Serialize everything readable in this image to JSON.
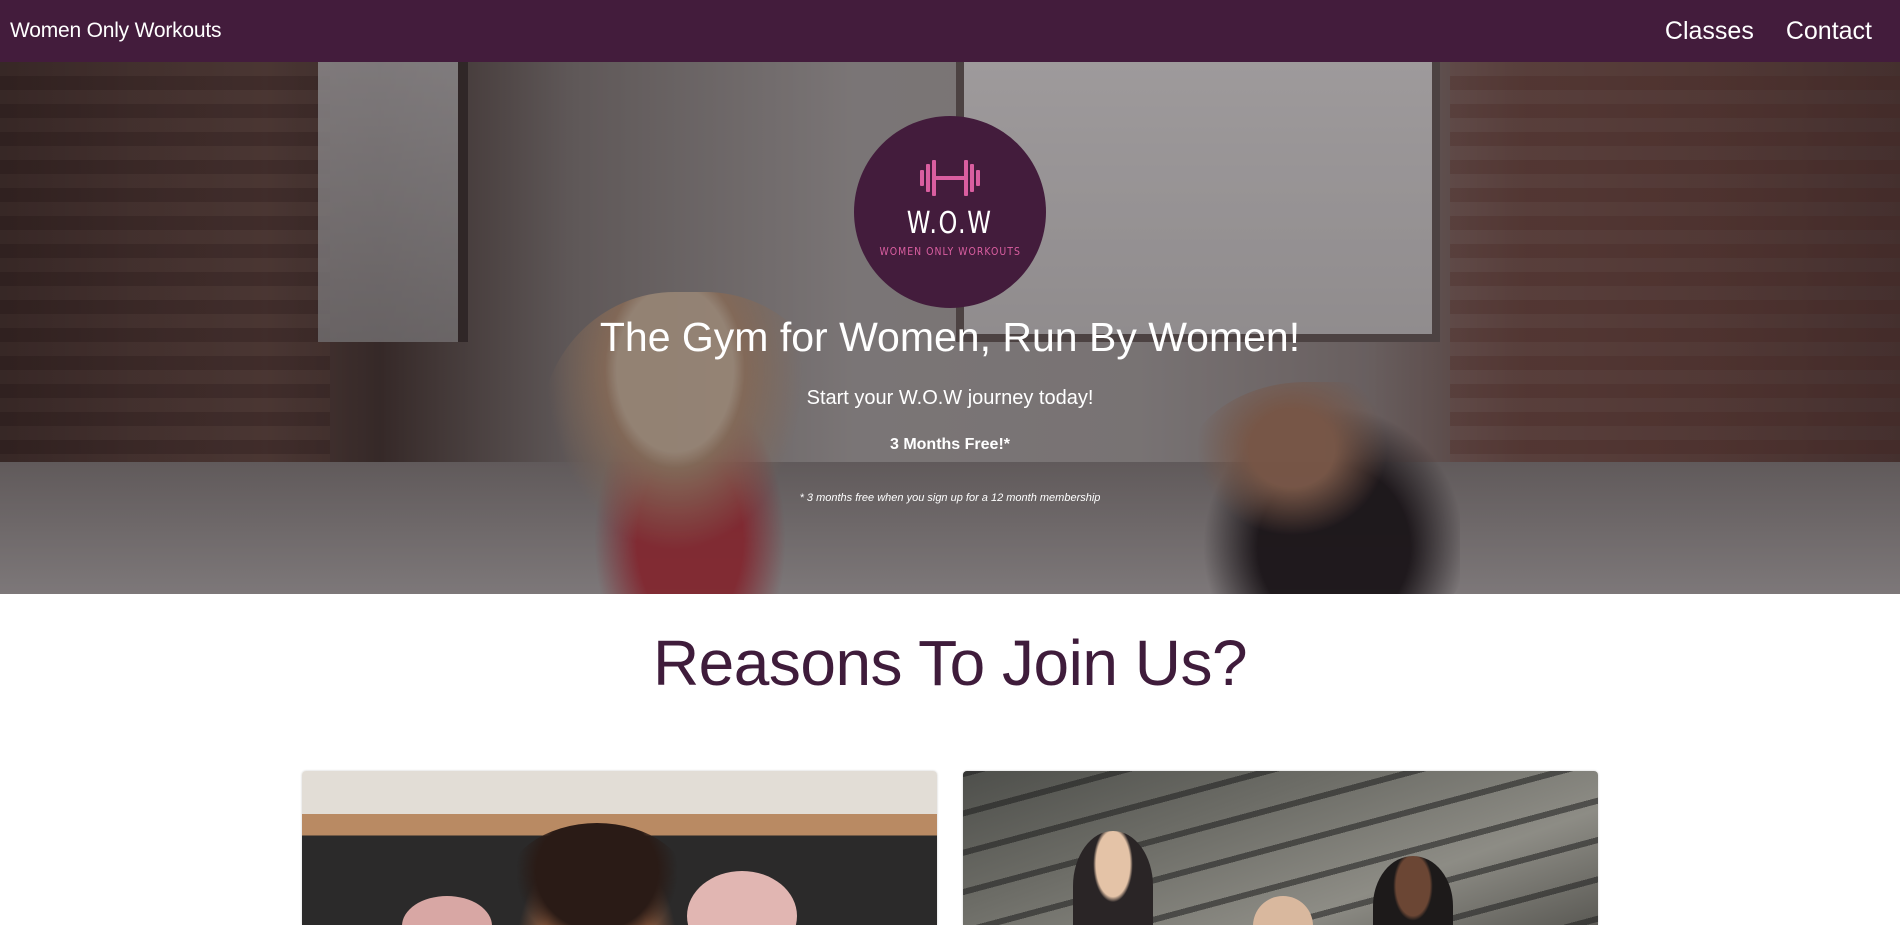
{
  "navbar": {
    "brand": "Women Only Workouts",
    "links": [
      {
        "label": "Classes"
      },
      {
        "label": "Contact"
      }
    ]
  },
  "hero": {
    "logo": {
      "icon": "dumbbell-icon",
      "title": "W.O.W",
      "subtitle": "WOMEN ONLY WORKOUTS"
    },
    "title": "The Gym for Women, Run By Women!",
    "subtitle": "Start your W.O.W journey today!",
    "offer": "3 Months Free!*",
    "footnote": "* 3 months free when you sign up for a 12 month membership"
  },
  "reasons": {
    "title": "Reasons To Join Us?"
  },
  "colors": {
    "brand": "#431c3c",
    "accent": "#d95ea0",
    "heading": "#3f1c3b"
  }
}
